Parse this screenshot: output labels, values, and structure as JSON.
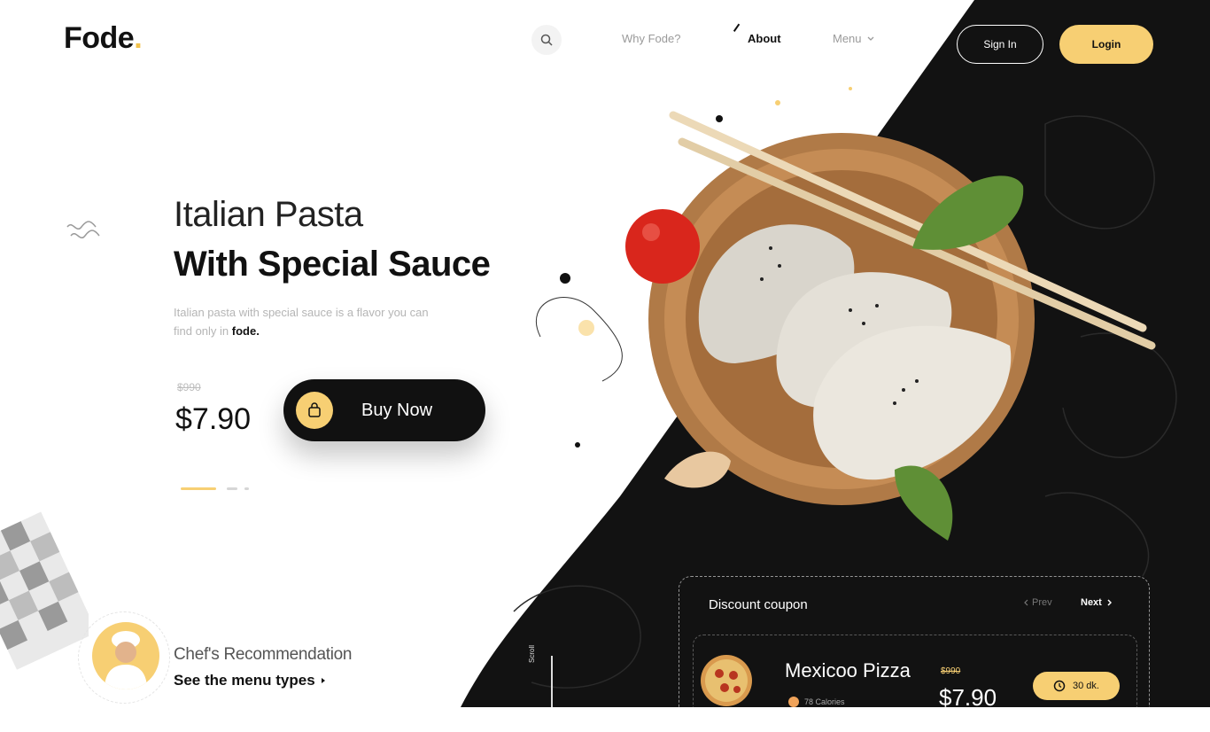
{
  "brand": {
    "name": "Fode",
    "dot": "."
  },
  "nav": {
    "links": [
      "Why Fode?",
      "About",
      "Menu"
    ],
    "active": "About",
    "signin_label": "Sign In",
    "login_label": "Login"
  },
  "hero": {
    "title_line1": "Italian Pasta",
    "title_line2": "With Special Sauce",
    "description": "Italian pasta with special sauce is a flavor you can find only in",
    "description_brand": "fode.",
    "old_price": "$990",
    "price": "$7.90",
    "buy_label": "Buy Now"
  },
  "chef": {
    "title": "Chef's Recommendation",
    "link_label": "See the menu types"
  },
  "scroll": {
    "label": "Scroll"
  },
  "coupon": {
    "title": "Discount coupon",
    "prev_label": "Prev",
    "next_label": "Next",
    "item": {
      "name": "Mexicoo Pizza",
      "calories": "78 Calories",
      "old_price": "$990",
      "price": "$7.90",
      "days": "30 dk."
    }
  },
  "colors": {
    "accent": "#f7cf73",
    "dark": "#111111",
    "text_muted": "#9a9a9a"
  },
  "icons": [
    "search-icon",
    "wave-icon",
    "shopping-bag-icon",
    "chevron-right-icon",
    "chevron-left-icon",
    "clock-icon",
    "fire-icon",
    "chevron-down-icon"
  ]
}
